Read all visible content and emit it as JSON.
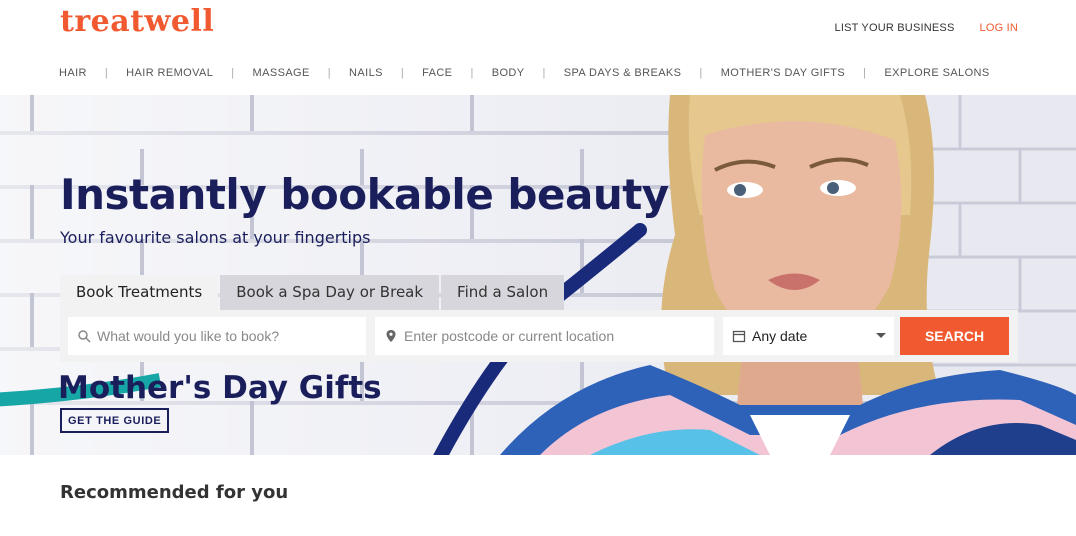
{
  "brand": {
    "logo_text": "treatwell",
    "accent": "#f15a30",
    "navy": "#1a1f5c"
  },
  "top_links": {
    "list_business": "LIST YOUR BUSINESS",
    "login": "LOG IN"
  },
  "nav": {
    "items": [
      "HAIR",
      "HAIR REMOVAL",
      "MASSAGE",
      "NAILS",
      "FACE",
      "BODY",
      "SPA DAYS & BREAKS",
      "MOTHER'S DAY GIFTS",
      "EXPLORE SALONS"
    ],
    "separator": "|"
  },
  "hero": {
    "headline": "Instantly bookable beauty",
    "subhead": "Your favourite salons at your fingertips",
    "tabs": [
      "Book Treatments",
      "Book a Spa Day or Break",
      "Find a Salon"
    ],
    "active_tab": 0,
    "search": {
      "what_placeholder": "What would you like to book?",
      "where_placeholder": "Enter postcode or current location",
      "date_value": "Any date",
      "button_label": "SEARCH"
    },
    "promo": {
      "title": "Mother's Day Gifts",
      "cta": "GET THE GUIDE"
    }
  },
  "sections": {
    "recommended_title": "Recommended for you"
  },
  "icons": [
    "search-icon",
    "location-pin-icon",
    "calendar-icon",
    "chevron-down-icon"
  ]
}
